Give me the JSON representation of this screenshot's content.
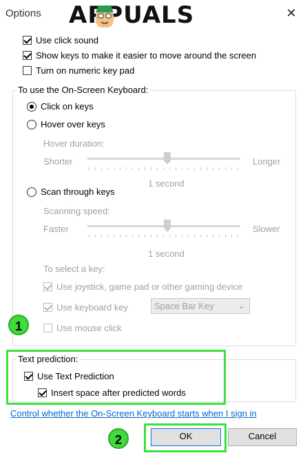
{
  "window": {
    "title": "Options",
    "close_glyph": "✕"
  },
  "watermark": {
    "text": "APPUALS"
  },
  "options": {
    "use_click_sound": {
      "label": "Use click sound",
      "checked": true
    },
    "show_keys": {
      "label": "Show keys to make it easier to move around the screen",
      "checked": true
    },
    "numeric_keypad": {
      "label": "Turn on numeric key pad",
      "checked": false
    }
  },
  "osk_group": {
    "label": "To use the On-Screen Keyboard:",
    "click_on_keys": "Click on keys",
    "hover_over_keys": "Hover over keys",
    "hover_duration": {
      "label": "Hover duration:",
      "min": "Shorter",
      "max": "Longer",
      "value": "1 second",
      "position": 0.5
    },
    "scan_through_keys": "Scan through keys",
    "scanning_speed": {
      "label": "Scanning speed:",
      "min": "Faster",
      "max": "Slower",
      "value": "1 second",
      "position": 0.5
    },
    "select_key_label": "To select a key:",
    "joystick": "Use joystick, game pad or other gaming device",
    "keyboard_key": "Use keyboard key",
    "keyboard_key_select": "Space Bar Key",
    "mouse_click": "Use mouse click"
  },
  "text_prediction": {
    "label": "Text prediction:",
    "use": {
      "label": "Use Text Prediction",
      "checked": true
    },
    "insert_space": {
      "label": "Insert space after predicted words",
      "checked": true
    }
  },
  "link": "Control whether the On-Screen Keyboard starts when I sign in",
  "buttons": {
    "ok": "OK",
    "cancel": "Cancel"
  },
  "badges": {
    "one": "1",
    "two": "2"
  },
  "colors": {
    "highlight": "#3de03a",
    "link": "#0066cc"
  }
}
